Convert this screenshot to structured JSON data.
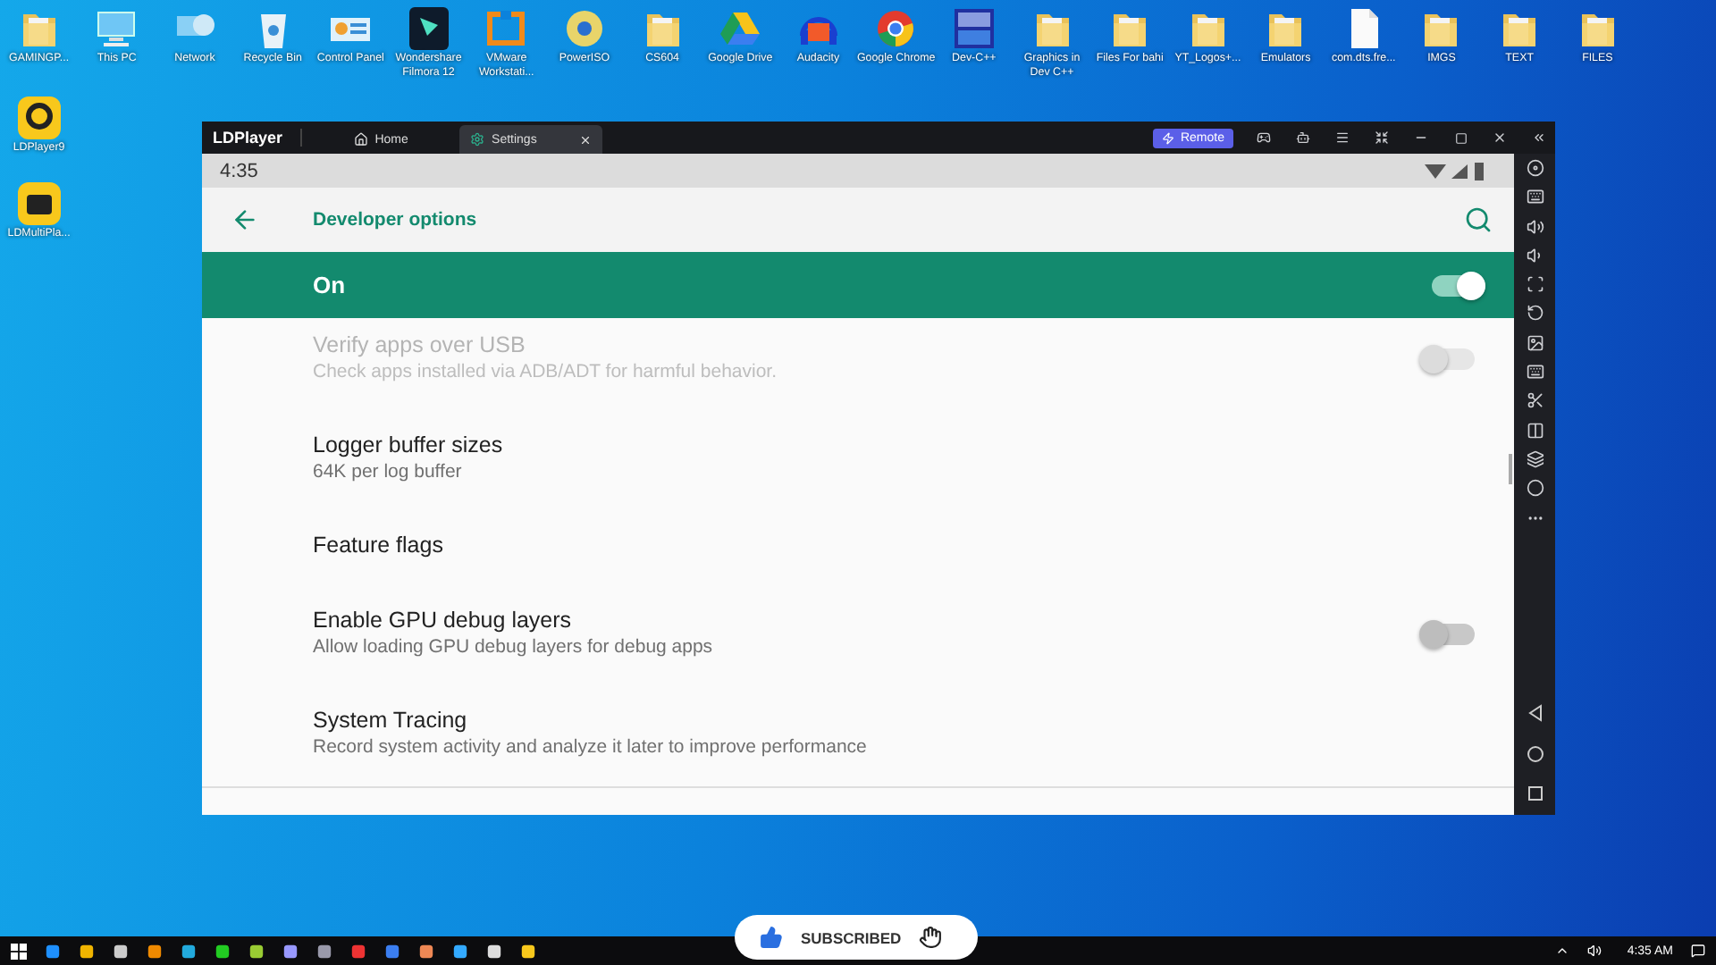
{
  "desktop_icons": [
    {
      "label": "GAMINGP...",
      "kind": "userfolder"
    },
    {
      "label": "This PC",
      "kind": "pc"
    },
    {
      "label": "Network",
      "kind": "network"
    },
    {
      "label": "Recycle Bin",
      "kind": "recycle"
    },
    {
      "label": "Control Panel",
      "kind": "control"
    },
    {
      "label": "Wondershare Filmora 12",
      "kind": "filmora"
    },
    {
      "label": "VMware Workstati...",
      "kind": "vmware"
    },
    {
      "label": "PowerISO",
      "kind": "disc"
    },
    {
      "label": "CS604",
      "kind": "folder"
    },
    {
      "label": "Google Drive",
      "kind": "drive"
    },
    {
      "label": "Audacity",
      "kind": "headphones"
    },
    {
      "label": "Google Chrome",
      "kind": "chrome"
    },
    {
      "label": "Dev-C++",
      "kind": "dev"
    },
    {
      "label": "Graphics in Dev C++",
      "kind": "folder"
    },
    {
      "label": "Files For bahi",
      "kind": "folder"
    },
    {
      "label": "YT_Logos+...",
      "kind": "folder"
    },
    {
      "label": "Emulators",
      "kind": "folder"
    },
    {
      "label": "com.dts.fre...",
      "kind": "file"
    },
    {
      "label": "IMGS",
      "kind": "folder"
    },
    {
      "label": "TEXT",
      "kind": "folder"
    },
    {
      "label": "FILES",
      "kind": "folder"
    }
  ],
  "side_icons": [
    {
      "label": "LDPlayer9",
      "kind": "ldplayer"
    },
    {
      "label": "LDMultiPla...",
      "kind": "ldmulti"
    }
  ],
  "window": {
    "logo": "LDPlayer",
    "tabs": [
      {
        "label": "Home",
        "selected": false,
        "closable": false
      },
      {
        "label": "Settings",
        "selected": true,
        "closable": true
      }
    ],
    "remote_button": "Remote",
    "android": {
      "time": "4:35",
      "title": "Developer options",
      "master": {
        "label": "On",
        "on": true
      },
      "items": [
        {
          "kind": "toggle",
          "title": "Verify apps over USB",
          "subtitle": "Check apps installed via ADB/ADT for harmful behavior.",
          "disabled": true,
          "on": false
        },
        {
          "kind": "plain",
          "title": "Logger buffer sizes",
          "subtitle": "64K per log buffer",
          "disabled": false
        },
        {
          "kind": "plain",
          "title": "Feature flags",
          "disabled": false
        },
        {
          "kind": "toggle",
          "title": "Enable GPU debug layers",
          "subtitle": "Allow loading GPU debug layers for debug apps",
          "disabled": false,
          "on": false
        },
        {
          "kind": "plain",
          "title": "System Tracing",
          "subtitle": "Record system activity and analyze it later to improve performance",
          "disabled": false
        }
      ]
    }
  },
  "overlay": {
    "label": "SUBSCRIBED"
  },
  "taskbar": {
    "clock": "4:35 AM"
  }
}
